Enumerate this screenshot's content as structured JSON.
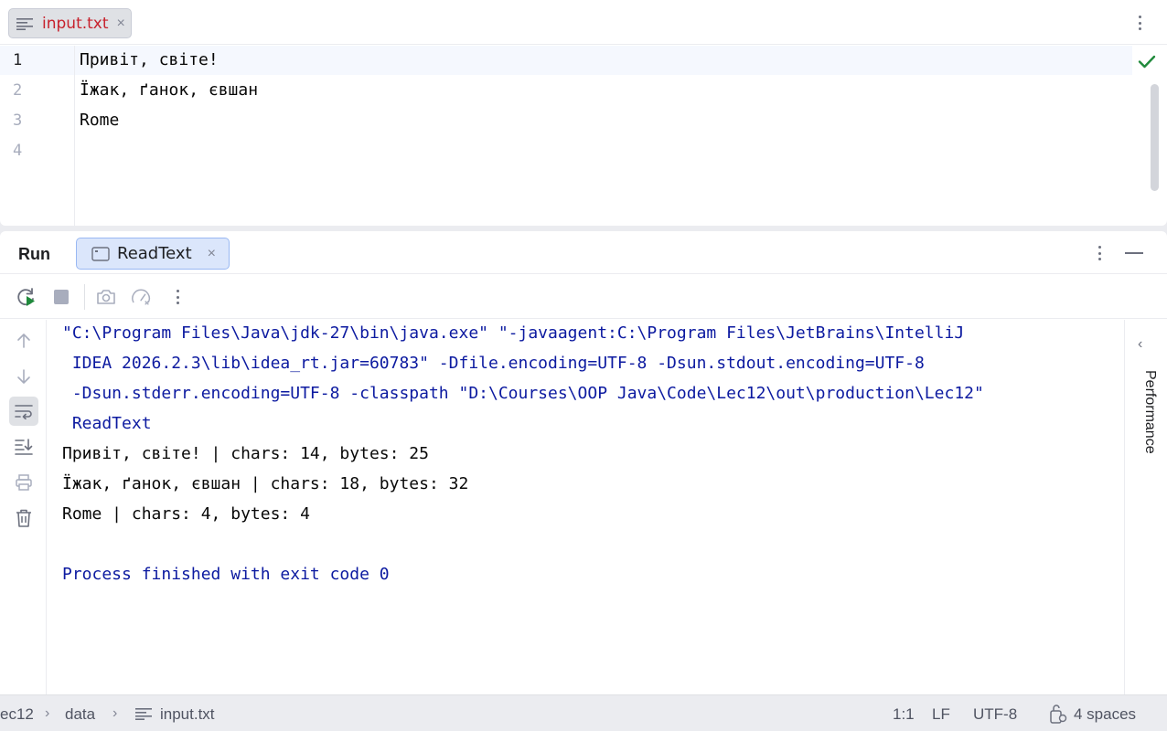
{
  "editor": {
    "tab_label": "input.txt",
    "tab_close": "×",
    "line_numbers": [
      "1",
      "2",
      "3",
      "4"
    ],
    "lines": [
      "Привіт, світе!",
      "Їжак, ґанок, євшан",
      "Rome",
      ""
    ],
    "analysis_status_icon": "check-icon"
  },
  "run": {
    "title": "Run",
    "config_tab_label": "ReadText",
    "config_tab_close": "×",
    "toolbar_icons": [
      "rerun-icon",
      "stop-icon",
      "camera-icon",
      "profiler-icon",
      "more-icon"
    ],
    "side_icons": [
      "arrow-up-icon",
      "arrow-down-icon",
      "soft-wrap-icon",
      "scroll-to-end-icon",
      "print-icon",
      "trash-icon"
    ],
    "console_lines": [
      {
        "text": "\"C:\\Program Files\\Java\\jdk-27\\bin\\java.exe\" \"-javaagent:C:\\Program Files\\JetBrains\\IntelliJ",
        "kind": "sys"
      },
      {
        "text": " IDEA 2026.2.3\\lib\\idea_rt.jar=60783\" -Dfile.encoding=UTF-8 -Dsun.stdout.encoding=UTF-8",
        "kind": "sys"
      },
      {
        "text": " -Dsun.stderr.encoding=UTF-8 -classpath \"D:\\Courses\\OOP Java\\Code\\Lec12\\out\\production\\Lec12\"",
        "kind": "sys"
      },
      {
        "text": " ReadText",
        "kind": "sys"
      },
      {
        "text": "Привіт, світе! | chars: 14, bytes: 25",
        "kind": "out"
      },
      {
        "text": "Їжак, ґанок, євшан | chars: 18, bytes: 32",
        "kind": "out"
      },
      {
        "text": "Rome | chars: 4, bytes: 4",
        "kind": "out"
      },
      {
        "text": "",
        "kind": "out"
      },
      {
        "text": "Process finished with exit code 0",
        "kind": "exit"
      }
    ],
    "right_panel_label": "Performance"
  },
  "status_bar": {
    "breadcrumb": [
      "ec12",
      "data",
      "input.txt"
    ],
    "position": "1:1",
    "line_separator": "LF",
    "encoding": "UTF-8",
    "indent": "4 spaces"
  },
  "colors": {
    "accent": "#3574f0",
    "tab_file_text": "#c7222d",
    "console_system": "#0c1aa0",
    "success": "#208a3c"
  }
}
